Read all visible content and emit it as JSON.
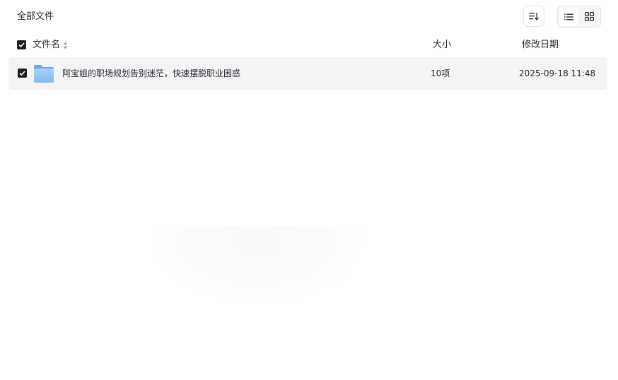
{
  "header": {
    "breadcrumb": "全部文件"
  },
  "toolbar": {
    "sort_icon": "sort-icon",
    "view_list_icon": "list-view-icon",
    "view_grid_icon": "grid-view-icon",
    "active_view": "list"
  },
  "table": {
    "columns": {
      "name": "文件名",
      "size": "大小",
      "date": "修改日期"
    },
    "rows": [
      {
        "name": "阿宝姐的职场规划告别迷茫，快速摆脱职业困惑",
        "size": "10项",
        "date": "2025-09-18 11:48",
        "icon": "folder-icon",
        "checked": true
      }
    ],
    "select_all_checked": true
  },
  "colors": {
    "text": "#252933",
    "checkbox": "#1f1f1f",
    "row_highlight": "#f4f4f5",
    "folder_blue": "#8fc4f6"
  }
}
